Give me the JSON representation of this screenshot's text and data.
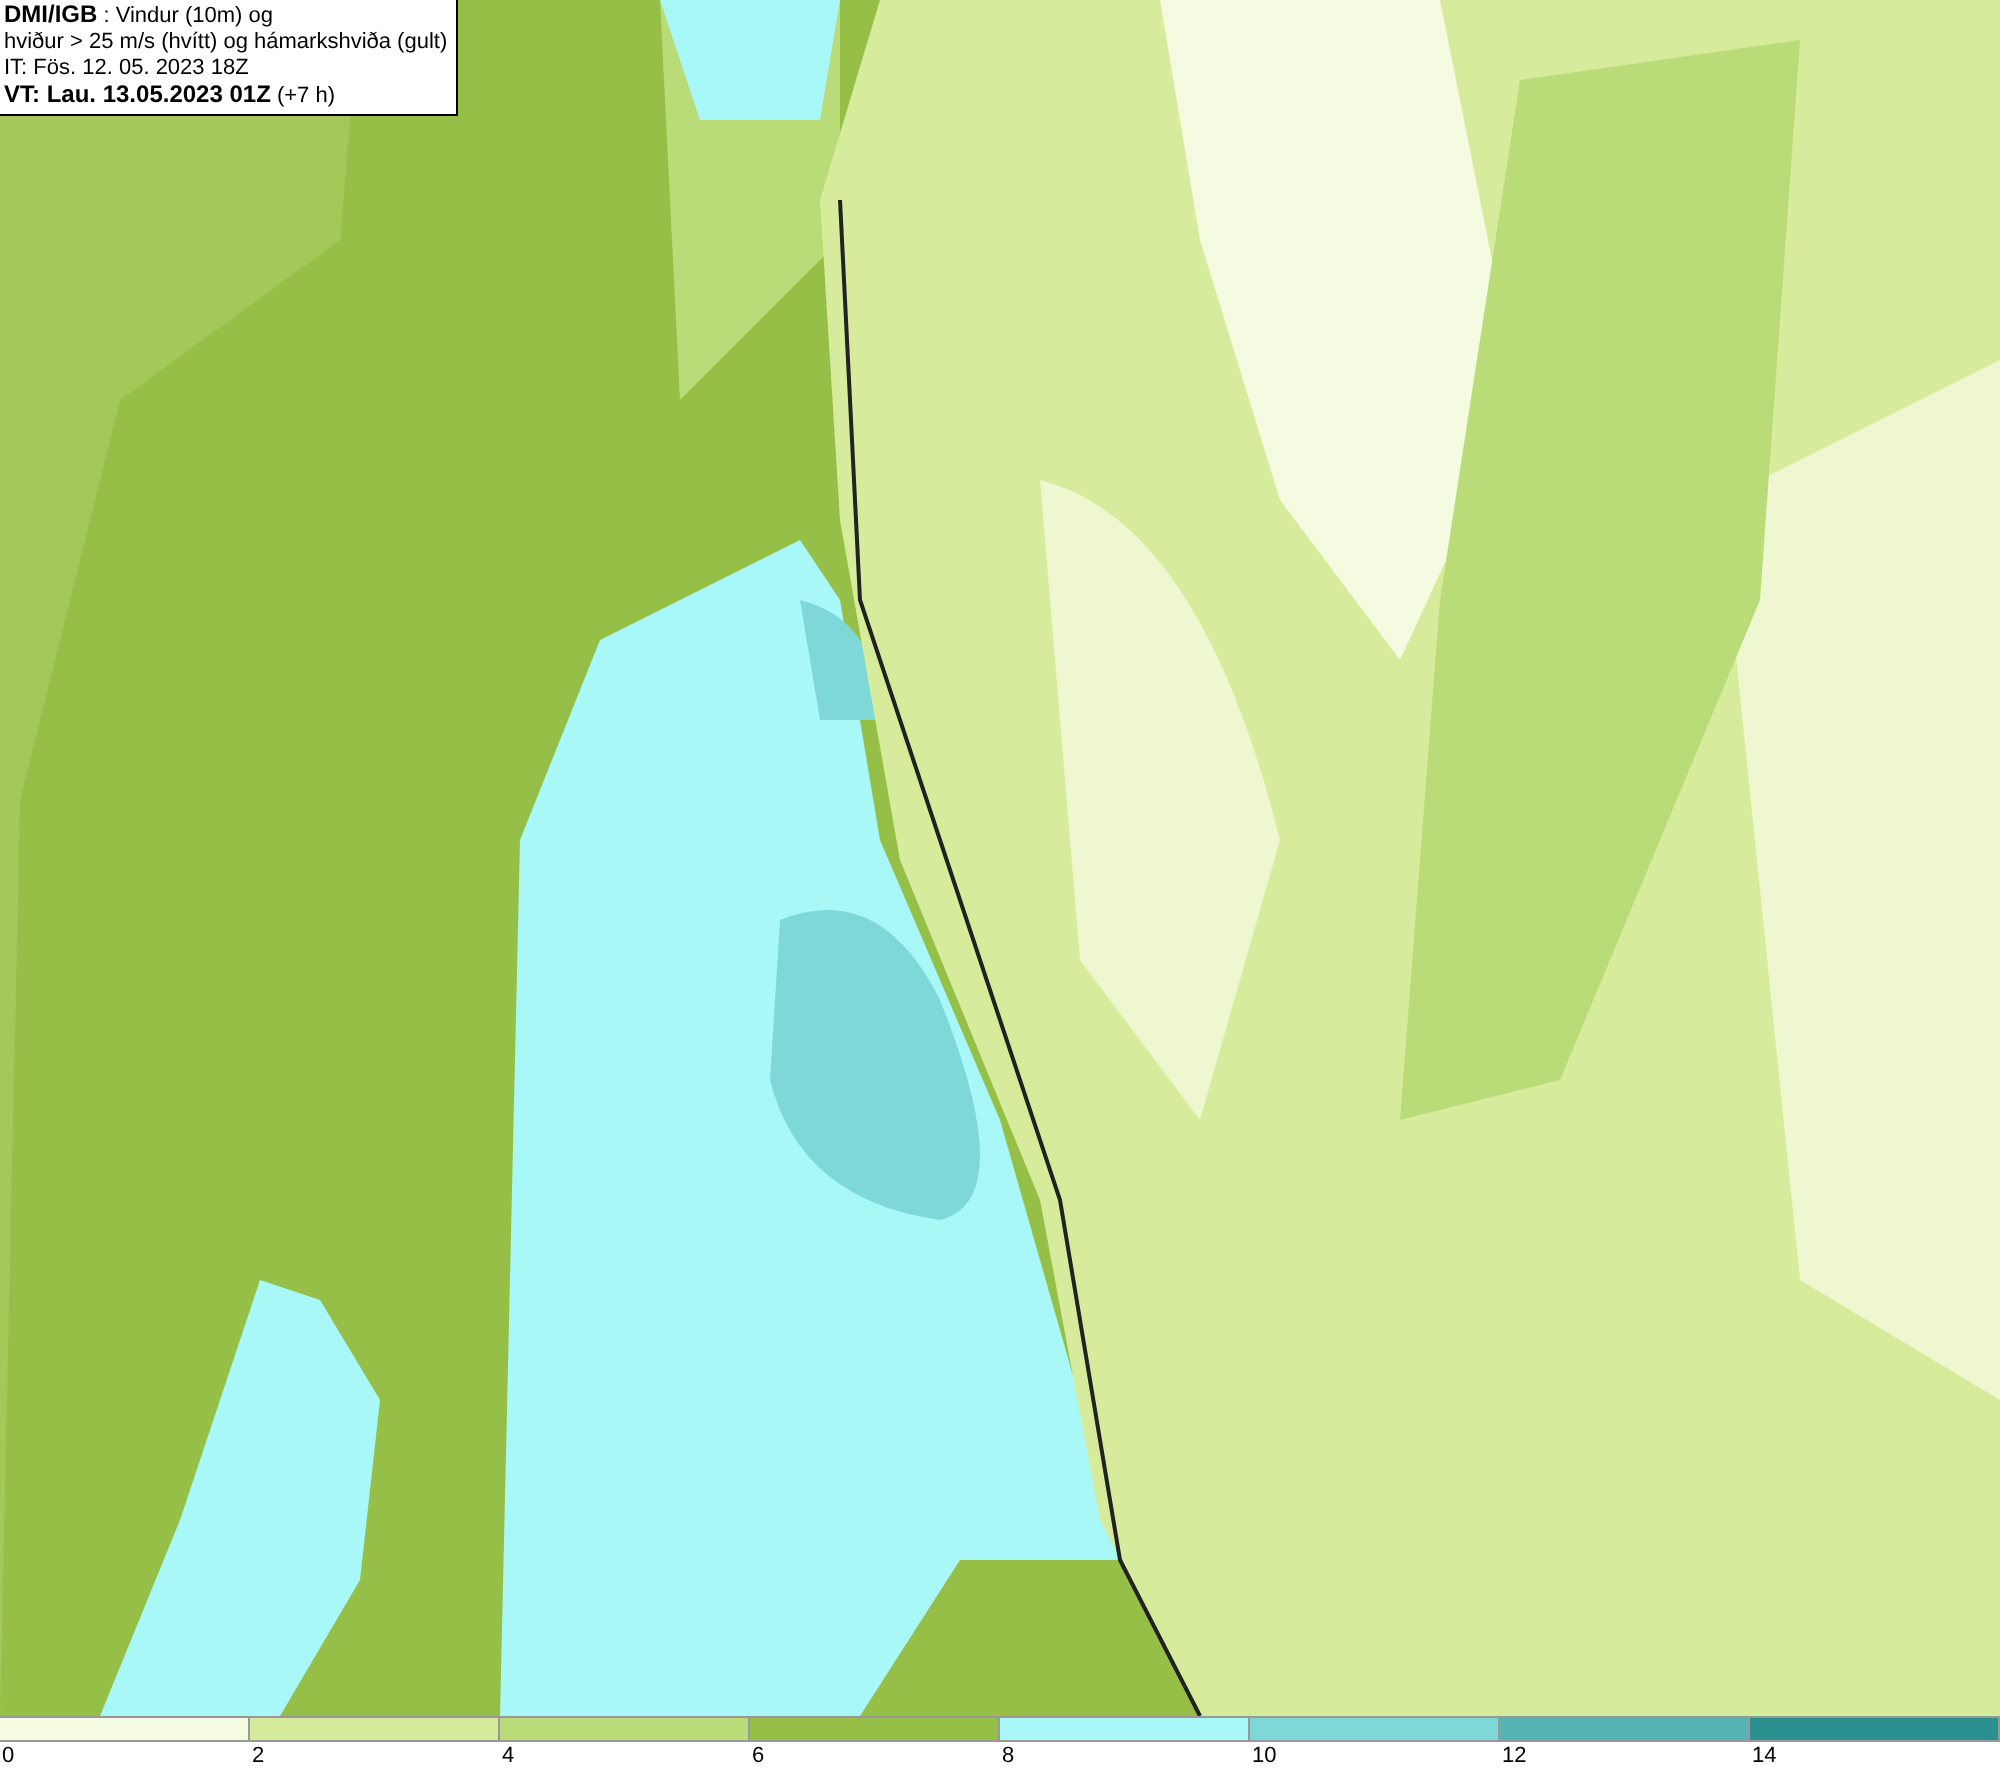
{
  "header": {
    "lines": [
      "**DMI/IGB** : Vindur (10m) og",
      "hviður > 25 m/s (hvítt) og hámarkshviða (gult)",
      "IT: Fös. 12. 05. 2023 18Z",
      "**VT: Lau. 13.05.2023 01Z** (+7 h)"
    ]
  },
  "legend": {
    "bins": [
      {
        "label": "0",
        "color": "#f5fbe0"
      },
      {
        "label": "2",
        "color": "#d6ec9c"
      },
      {
        "label": "4",
        "color": "#b9dc78"
      },
      {
        "label": "6",
        "color": "#96bf48"
      },
      {
        "label": "8",
        "color": "#a8f8f8"
      },
      {
        "label": "10",
        "color": "#7fd8d8"
      },
      {
        "label": "12",
        "color": "#55b4b4"
      },
      {
        "label": "14",
        "color": "#2a9090"
      }
    ]
  }
}
